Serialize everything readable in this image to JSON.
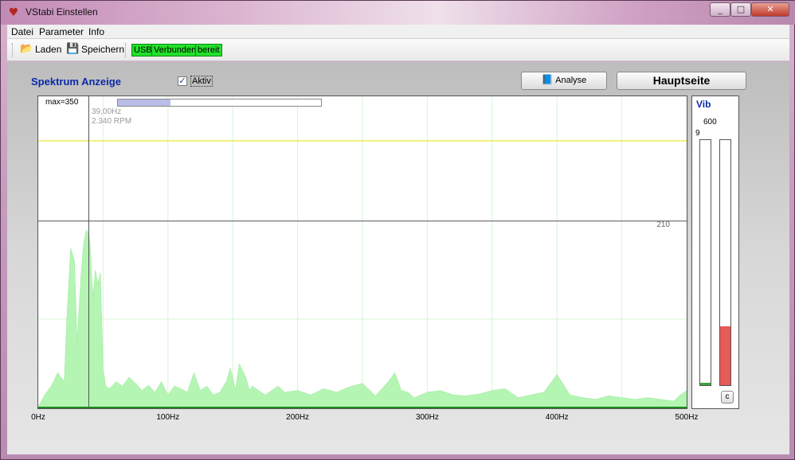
{
  "window": {
    "title": "VStabi Einstellen",
    "min": "_",
    "max": "□",
    "close": "✕"
  },
  "menu": [
    "Datei",
    "Parameter",
    "Info"
  ],
  "toolbar": {
    "laden": "Laden",
    "speichern": "Speichern",
    "usb": "USB",
    "verbunden": "Verbunden",
    "bereit": "bereit",
    "laden_icon": "open-folder-icon",
    "speichern_icon": "save-disk-icon"
  },
  "spectrum": {
    "title": "Spektrum Anzeige",
    "aktiv_label": "Aktiv",
    "aktiv_checked": true,
    "analyse_label": "Analyse",
    "hauptseite_label": "Hauptseite",
    "max_label": "max=350",
    "freq_readout": "39,00Hz",
    "rpm_readout": "2.340 RPM",
    "level_label": "210",
    "progress": 0.26
  },
  "chart_data": {
    "type": "area",
    "x_unit": "Hz",
    "xlim": [
      0,
      500
    ],
    "ylim": [
      0,
      350
    ],
    "x_ticks": [
      "0Hz",
      "100Hz",
      "200Hz",
      "300Hz",
      "400Hz",
      "500Hz"
    ],
    "cursor_x": 39,
    "reference_lines": [
      {
        "y": 210,
        "label": "210"
      },
      {
        "y": 300,
        "color": "#e6e600"
      }
    ],
    "grid": true,
    "series": [
      {
        "color": "#b4f5b4",
        "x": [
          0,
          5,
          10,
          15,
          20,
          22,
          25,
          28,
          30,
          33,
          35,
          37,
          38,
          39,
          40,
          42,
          44,
          46,
          48,
          50,
          52,
          55,
          60,
          65,
          70,
          75,
          80,
          85,
          90,
          95,
          100,
          105,
          110,
          115,
          120,
          125,
          130,
          135,
          140,
          145,
          148,
          150,
          152,
          155,
          160,
          163,
          165,
          170,
          175,
          180,
          185,
          190,
          200,
          210,
          220,
          230,
          240,
          250,
          260,
          270,
          275,
          280,
          285,
          290,
          300,
          310,
          320,
          330,
          340,
          350,
          360,
          370,
          380,
          390,
          400,
          410,
          420,
          430,
          440,
          450,
          460,
          470,
          480,
          490,
          495,
          500
        ],
        "y": [
          2,
          15,
          25,
          40,
          30,
          100,
          180,
          165,
          75,
          150,
          185,
          200,
          198,
          195,
          185,
          125,
          155,
          140,
          152,
          45,
          25,
          22,
          30,
          25,
          35,
          28,
          20,
          26,
          18,
          30,
          15,
          25,
          22,
          18,
          40,
          20,
          25,
          15,
          18,
          30,
          45,
          35,
          20,
          50,
          35,
          20,
          25,
          20,
          15,
          20,
          25,
          18,
          20,
          15,
          22,
          18,
          24,
          28,
          14,
          30,
          40,
          20,
          18,
          12,
          18,
          20,
          15,
          14,
          16,
          20,
          22,
          12,
          15,
          18,
          38,
          15,
          12,
          10,
          14,
          12,
          10,
          12,
          10,
          8,
          15,
          20
        ]
      }
    ]
  },
  "vib": {
    "title": "Vib",
    "max_label": "600",
    "left_label": "9",
    "clear_label": "c",
    "left_level": 0.01,
    "right_level": 0.24
  }
}
